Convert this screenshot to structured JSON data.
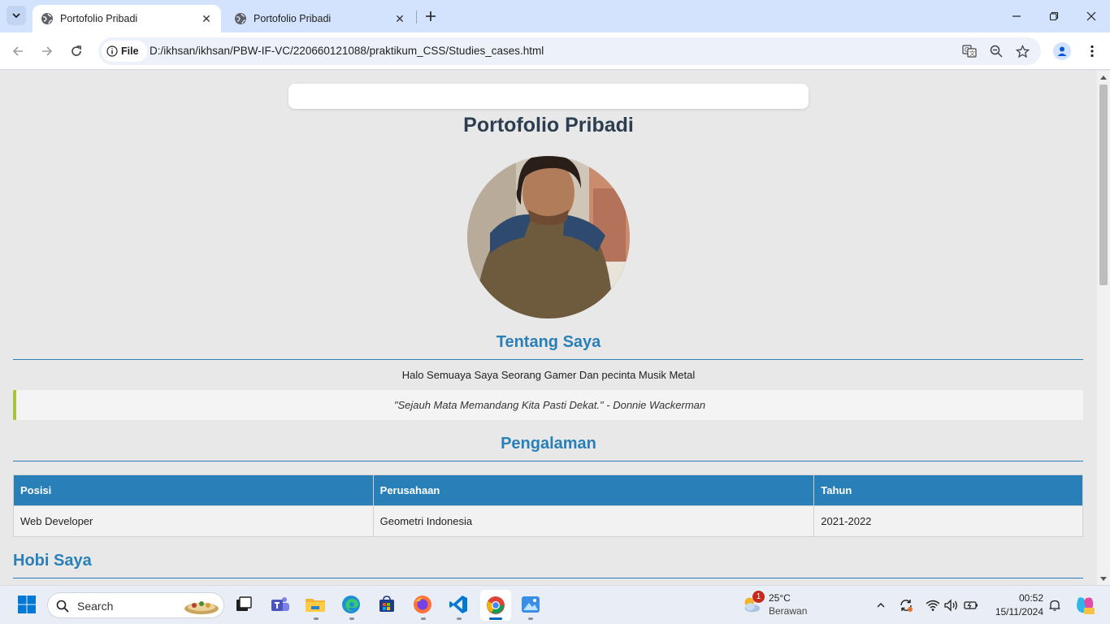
{
  "browser": {
    "tabs": [
      {
        "title": "Portofolio Pribadi",
        "active": true
      },
      {
        "title": "Portofolio Pribadi",
        "active": false
      }
    ],
    "address": {
      "scheme_label": "File",
      "url": "D:/ikhsan/ikhsan/PBW-IF-VC/220660121088/praktikum_CSS/Studies_cases.html"
    }
  },
  "page": {
    "title": "Portofolio Pribadi",
    "about": {
      "heading": "Tentang Saya",
      "text": "Halo Semuaya Saya Seorang Gamer Dan pecinta Musik Metal",
      "quote": "\"Sejauh Mata Memandang Kita Pasti Dekat.\" - Donnie Wackerman"
    },
    "experience": {
      "heading": "Pengalaman",
      "columns": [
        "Posisi",
        "Perusahaan",
        "Tahun"
      ],
      "rows": [
        [
          "Web Developer",
          "Geometri Indonesia",
          "2021-2022"
        ]
      ]
    },
    "hobbies": {
      "heading": "Hobi Saya"
    }
  },
  "taskbar": {
    "search_label": "Search",
    "weather": {
      "temp": "25°C",
      "desc": "Berawan",
      "badge": "1"
    },
    "clock": {
      "time": "00:52",
      "date": "15/11/2024"
    }
  },
  "colors": {
    "accent": "#2980b9",
    "title": "#2c3e50",
    "quote_border": "#a8c43a",
    "page_bg": "#e8e8e8"
  }
}
